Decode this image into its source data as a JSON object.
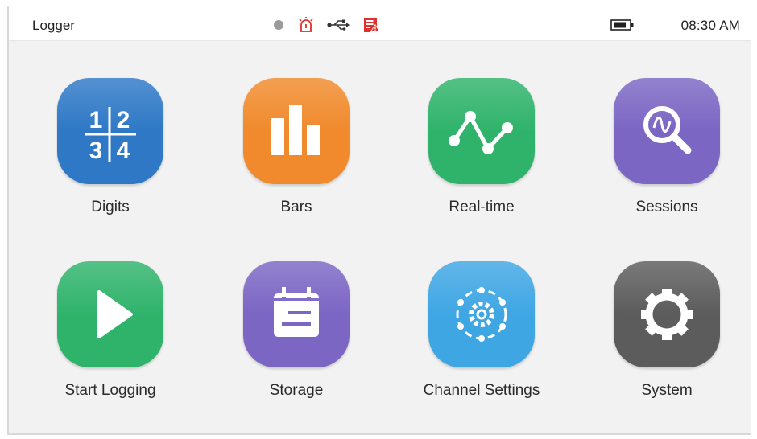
{
  "app_title": "Logger",
  "status": {
    "time": "08:30 AM",
    "icons": [
      "record-dot-icon",
      "alarm-icon",
      "usb-icon",
      "memory-warning-icon",
      "battery-icon"
    ]
  },
  "tiles": [
    {
      "label": "Digits",
      "icon": "digits-icon",
      "color": "#2e78c6"
    },
    {
      "label": "Bars",
      "icon": "bars-icon",
      "color": "#f08a2c"
    },
    {
      "label": "Real-time",
      "icon": "real-time-graph-icon",
      "color": "#2fb36b"
    },
    {
      "label": "Sessions",
      "icon": "sessions-search-icon",
      "color": "#7b66c4"
    },
    {
      "label": "Start Logging",
      "icon": "play-icon",
      "color": "#2fb36b"
    },
    {
      "label": "Storage",
      "icon": "storage-calendar-icon",
      "color": "#7b66c4"
    },
    {
      "label": "Channel Settings",
      "icon": "channel-settings-icon",
      "color": "#3fa6e4"
    },
    {
      "label": "System",
      "icon": "gear-icon",
      "color": "#5c5c5c"
    }
  ]
}
